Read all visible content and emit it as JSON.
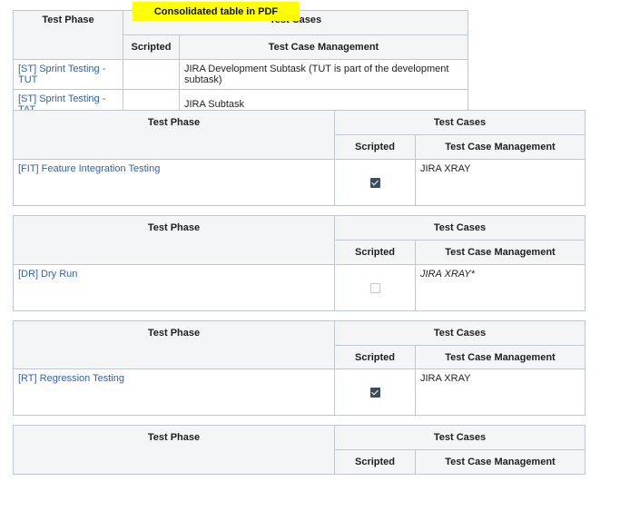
{
  "banner": "Consolidated table in PDF",
  "table1": {
    "header_phase": "Test Phase",
    "header_cases": "Test Cases",
    "header_scripted": "Scripted",
    "header_mgmt": "Test Case Management",
    "rows": [
      {
        "phase": "[ST] Sprint Testing - TUT",
        "scripted": "",
        "mgmt": "JIRA Development Subtask (TUT is part of the development subtask)"
      },
      {
        "phase": "[ST] Sprint Testing - TAT",
        "scripted": "",
        "mgmt": "JIRA Subtask"
      }
    ]
  },
  "table2": {
    "header_phase": "Test Phase",
    "header_cases": "Test Cases",
    "header_scripted": "Scripted",
    "header_mgmt": "Test Case Management",
    "row": {
      "phase": "[FIT] Feature Integration Testing",
      "scripted": true,
      "mgmt": "JIRA XRAY"
    }
  },
  "table3": {
    "header_phase": "Test Phase",
    "header_cases": "Test Cases",
    "header_scripted": "Scripted",
    "header_mgmt": "Test Case Management",
    "row": {
      "phase": "[DR] Dry Run",
      "scripted": false,
      "mgmt": "JIRA XRAY*"
    }
  },
  "table4": {
    "header_phase": "Test Phase",
    "header_cases": "Test Cases",
    "header_scripted": "Scripted",
    "header_mgmt": "Test Case Management",
    "row": {
      "phase": "[RT] Regression Testing",
      "scripted": true,
      "mgmt": "JIRA XRAY"
    }
  },
  "table5": {
    "header_phase": "Test Phase",
    "header_cases": "Test Cases",
    "header_scripted": "Scripted",
    "header_mgmt": "Test Case Management"
  }
}
